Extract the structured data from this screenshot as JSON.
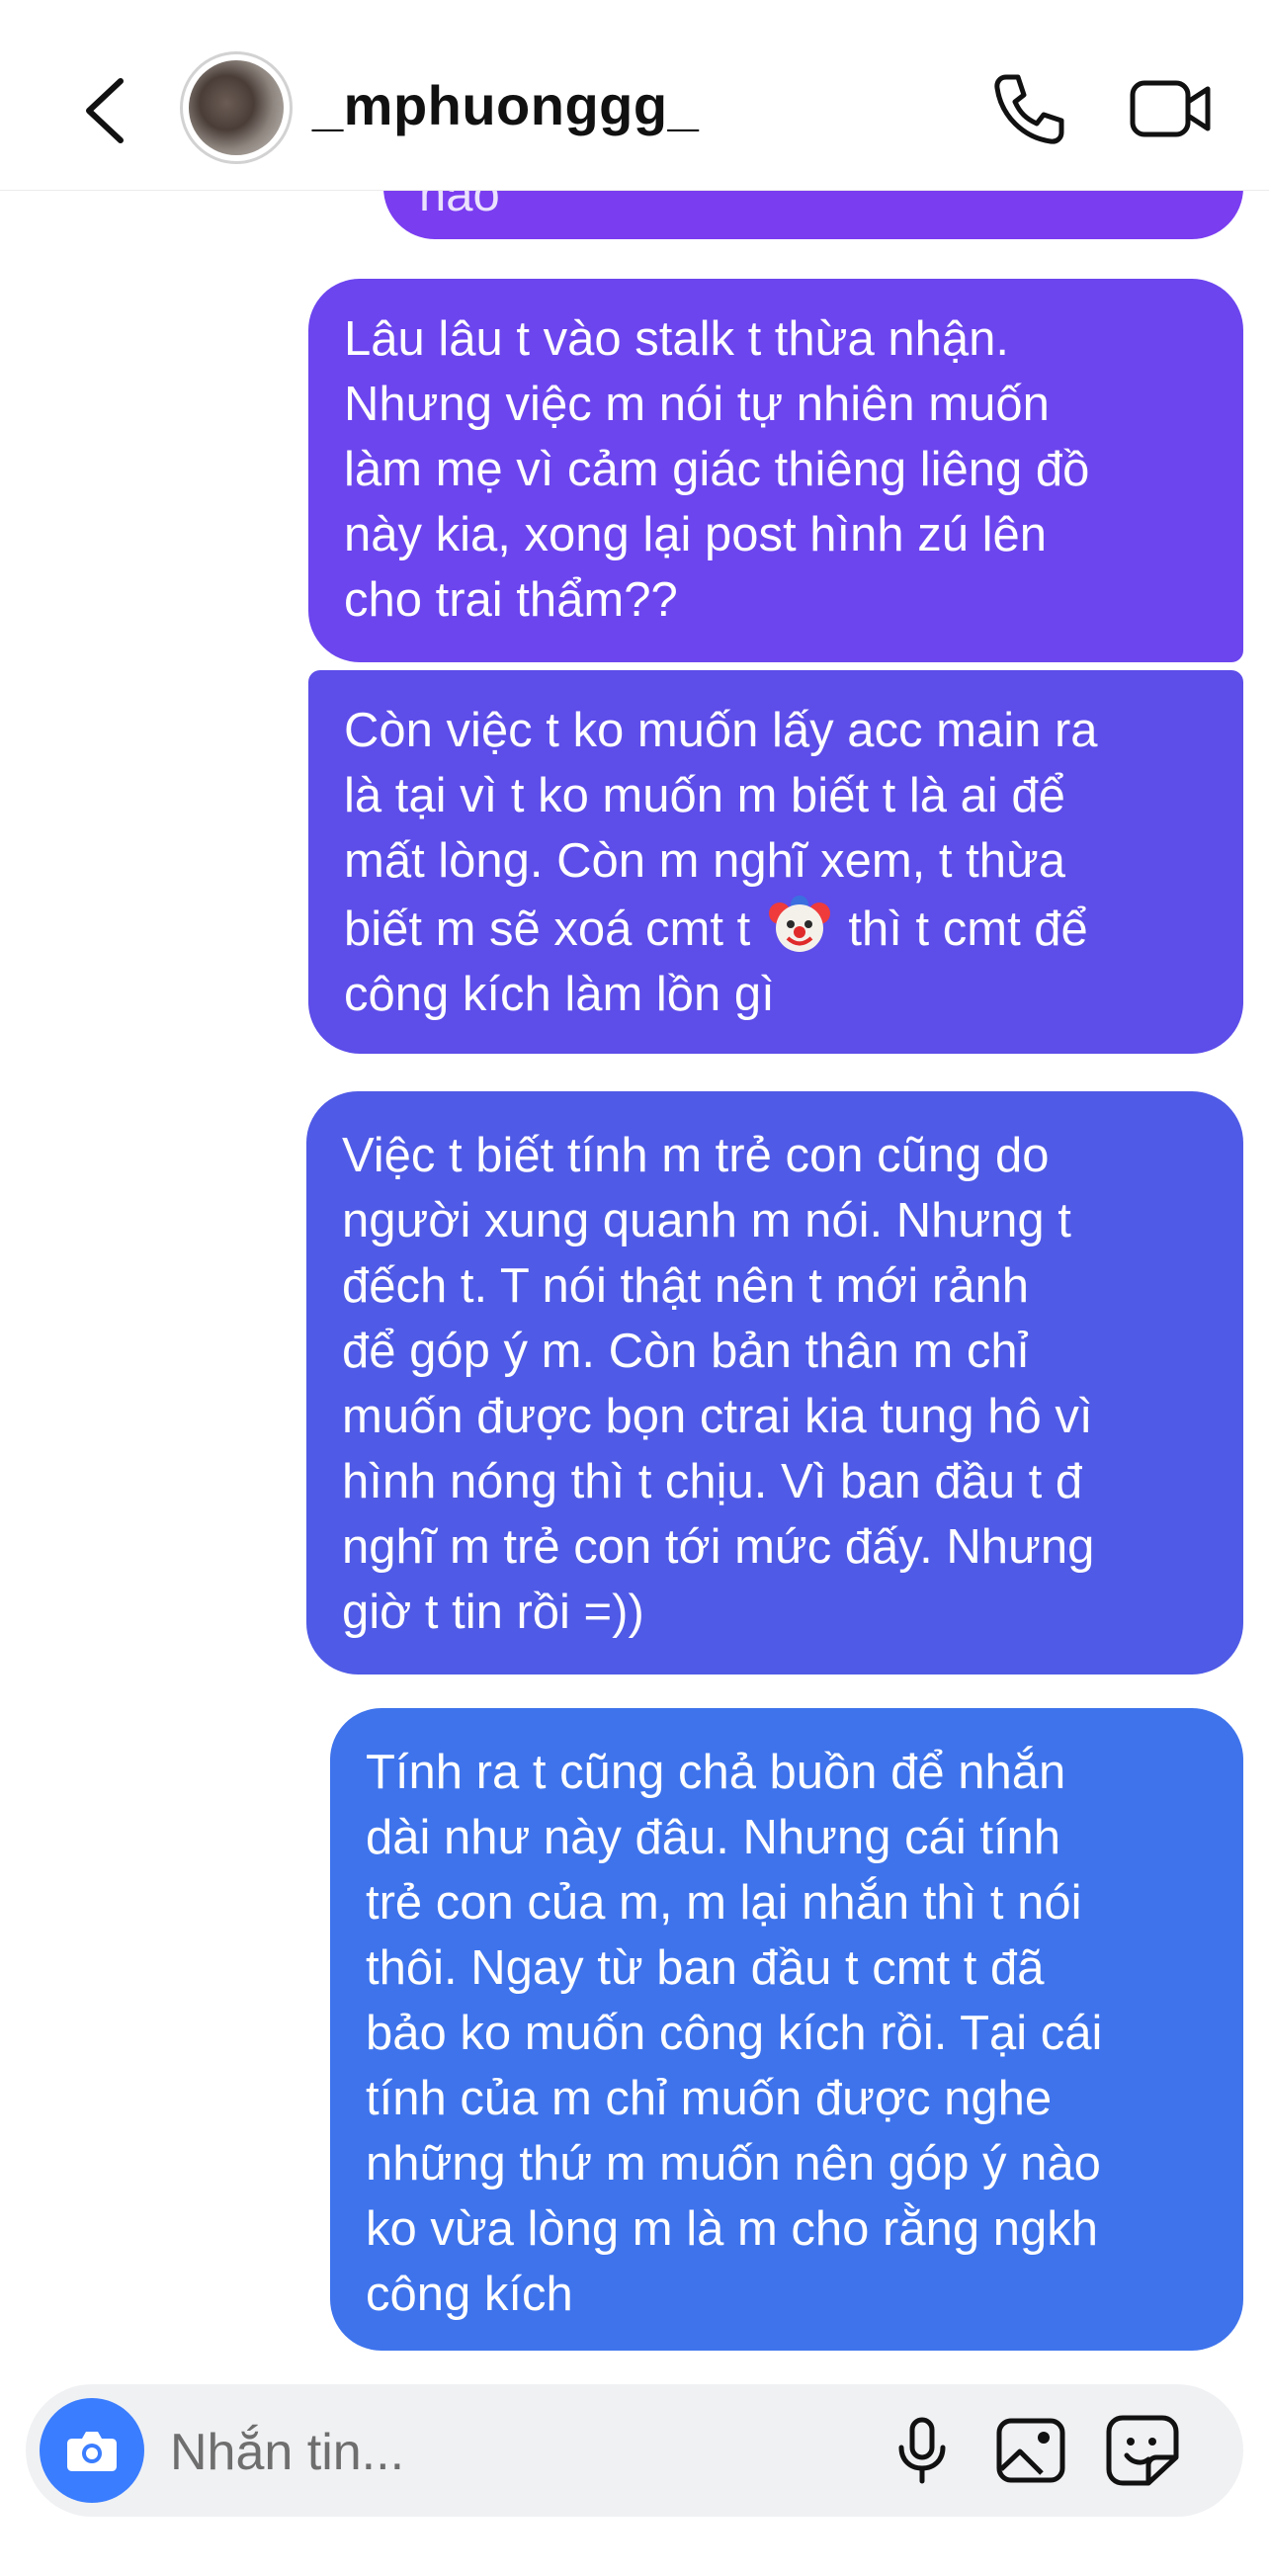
{
  "header": {
    "username": "_mphuonggg_"
  },
  "messages": [
    {
      "text": "nào"
    },
    {
      "text": "Lâu lâu t vào stalk t thừa nhận.\nNhưng việc m nói tự nhiên muốn\nlàm mẹ vì cảm giác thiêng liêng đồ\nnày kia, xong lại post hình zú lên\ncho trai thẩm??"
    },
    {
      "text_before": "Còn việc t ko muốn lấy acc main ra\nlà tại vì t ko muốn m biết t là ai để\nmất lòng. Còn m nghĩ xem, t thừa\nbiết m sẽ xoá cmt t ",
      "emoji": "clown-face",
      "text_after": " thì t cmt để\ncông kích làm lồn gì"
    },
    {
      "text": "Việc t biết tính m trẻ con cũng do\nngười xung quanh m nói. Nhưng t\nđếch t. T nói thật nên t mới rảnh\nđể góp ý m. Còn bản thân m chỉ\nmuốn được bọn ctrai kia tung hô vì\nhình nóng thì t chịu. Vì ban đầu t đ\nnghĩ m trẻ con tới mức đấy. Nhưng\ngiờ t tin rồi =))"
    },
    {
      "text": "Tính ra t cũng chả buồn để nhắn\ndài như này đâu. Nhưng cái tính\ntrẻ con của m, m lại nhắn thì t nói\nthôi. Ngay từ ban đầu t cmt t đã\nbảo ko muốn công kích rồi. Tại cái\ntính của m chỉ muốn được nghe\nnhững thứ m muốn nên góp ý nào\nko vừa lòng m là m cho rằng ngkh\ncông kích"
    }
  ],
  "composer": {
    "placeholder": "Nhắn tin..."
  },
  "icons": {
    "back": "chevron-left-icon",
    "call": "phone-icon",
    "video": "video-camera-icon",
    "camera": "camera-icon",
    "mic": "microphone-icon",
    "gallery": "image-icon",
    "sticker": "sticker-icon"
  },
  "colors": {
    "bubble_top": "#7a3df0",
    "bubble_bottom": "#3e73ec",
    "camera_button": "#3a7dff"
  }
}
